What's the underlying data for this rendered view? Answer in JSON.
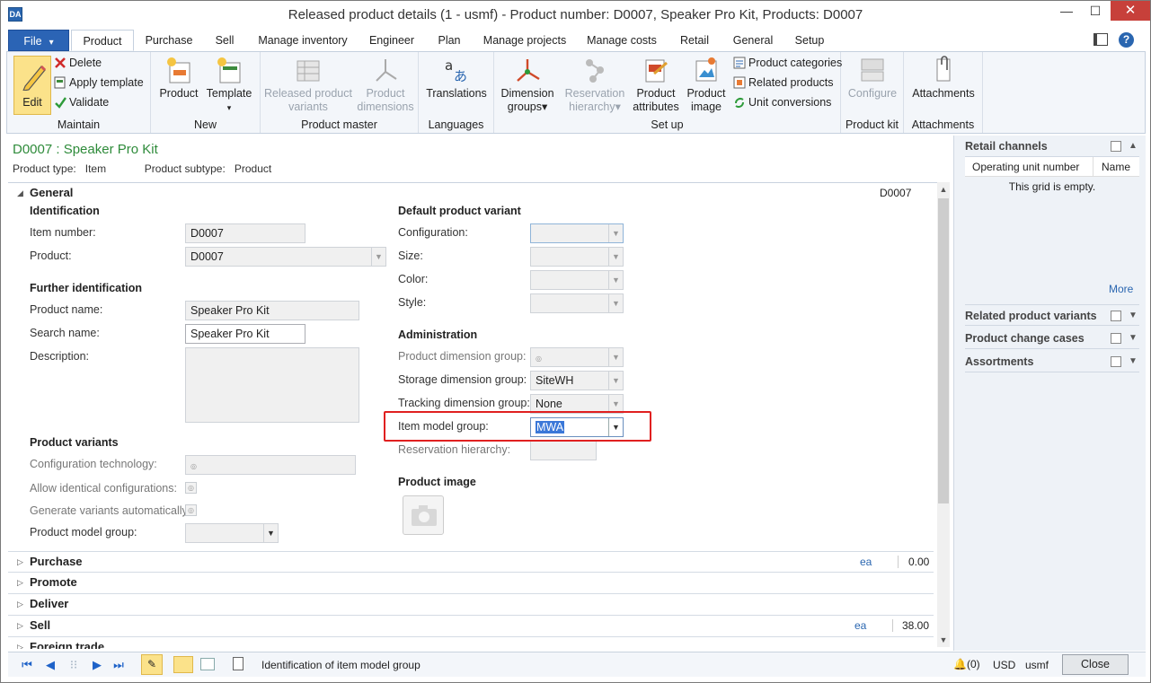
{
  "window": {
    "title": "Released product details (1 - usmf) - Product number: D0007, Speaker Pro Kit, Products: D0007",
    "app_icon": "DA",
    "min": "—",
    "max": "☐",
    "close": "✕"
  },
  "tabs": [
    "File",
    "Product",
    "Purchase",
    "Sell",
    "Manage inventory",
    "Engineer",
    "Plan",
    "Manage projects",
    "Manage costs",
    "Retail",
    "General",
    "Setup"
  ],
  "ribbon": {
    "maintain": {
      "label": "Maintain",
      "edit": "Edit",
      "delete": "Delete",
      "apply_template": "Apply template",
      "validate": "Validate"
    },
    "new": {
      "label": "New",
      "product": "Product",
      "template": "Template",
      "template_arrow": "▾"
    },
    "product_master": {
      "label": "Product master",
      "released_variants_1": "Released product",
      "released_variants_2": "variants",
      "dimensions_1": "Product",
      "dimensions_2": "dimensions"
    },
    "languages": {
      "label": "Languages",
      "translations": "Translations"
    },
    "setup": {
      "label": "Set up",
      "dimension_groups_1": "Dimension",
      "dimension_groups_2": "groups▾",
      "reservation_1": "Reservation",
      "reservation_2": "hierarchy▾",
      "attributes_1": "Product",
      "attributes_2": "attributes",
      "image_1": "Product",
      "image_2": "image",
      "categories": "Product categories",
      "related": "Related products",
      "unit_conversions": "Unit conversions"
    },
    "product_kit": {
      "label": "Product kit",
      "configure": "Configure"
    },
    "attachments": {
      "label": "Attachments",
      "attachments": "Attachments"
    }
  },
  "header": {
    "title": "D0007 : Speaker Pro Kit",
    "type_label": "Product type:",
    "type_value": "Item",
    "subtype_label": "Product subtype:",
    "subtype_value": "Product"
  },
  "general": {
    "title": "General",
    "code": "D0007",
    "identification": {
      "title": "Identification",
      "item_number_label": "Item number:",
      "item_number": "D0007",
      "product_label": "Product:",
      "product": "D0007"
    },
    "further": {
      "title": "Further identification",
      "name_label": "Product name:",
      "name": "Speaker Pro Kit",
      "search_label": "Search name:",
      "search": "Speaker Pro Kit",
      "desc_label": "Description:"
    },
    "variants": {
      "title": "Product variants",
      "config_tech": "Configuration technology:",
      "allow_identical": "Allow identical configurations:",
      "generate_auto": "Generate variants automatically:",
      "model_group": "Product model group:"
    },
    "default_variant": {
      "title": "Default product variant",
      "configuration": "Configuration:",
      "size": "Size:",
      "color": "Color:",
      "style": "Style:"
    },
    "administration": {
      "title": "Administration",
      "pdg_label": "Product dimension group:",
      "sdg_label": "Storage dimension group:",
      "sdg": "SiteWH",
      "tdg_label": "Tracking dimension group:",
      "tdg": "None",
      "img_label": "Item model group:",
      "img": "MWA",
      "res_label": "Reservation hierarchy:"
    },
    "image": {
      "title": "Product image"
    }
  },
  "sections": [
    {
      "title": "Purchase",
      "unit": "ea",
      "value": "0.00"
    },
    {
      "title": "Promote"
    },
    {
      "title": "Deliver"
    },
    {
      "title": "Sell",
      "unit": "ea",
      "value": "38.00"
    },
    {
      "title": "Foreign trade"
    }
  ],
  "side": {
    "retail_channels": "Retail channels",
    "col_unit": "Operating unit number",
    "col_name": "Name",
    "empty": "This grid is empty.",
    "more": "More",
    "related_variants": "Related product variants",
    "change_cases": "Product change cases",
    "assortments": "Assortments"
  },
  "status": {
    "text": "Identification of item model group",
    "notifications": "(0)",
    "currency": "USD",
    "company": "usmf",
    "close": "Close"
  }
}
